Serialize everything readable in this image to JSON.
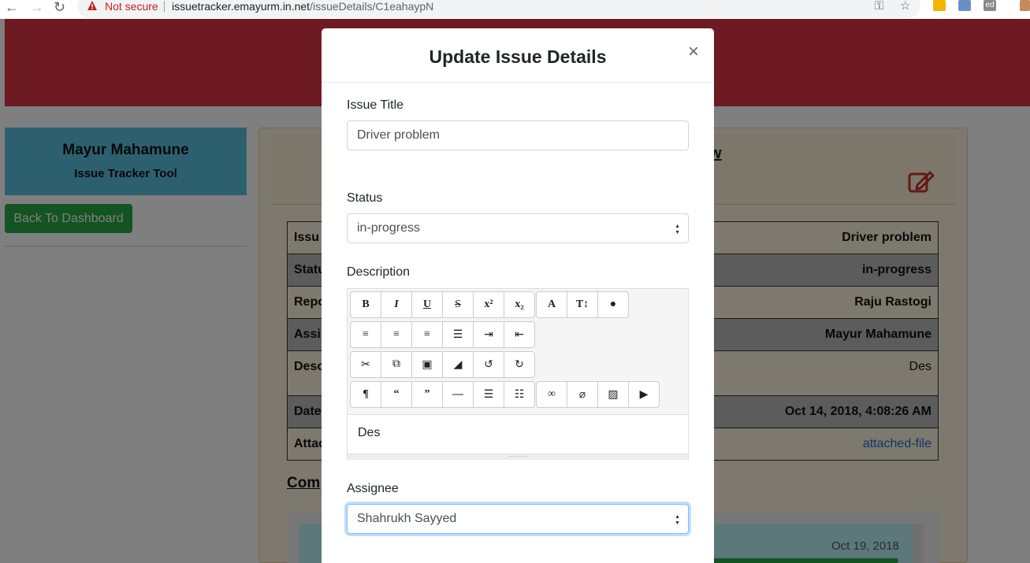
{
  "browser": {
    "not_secure": "Not secure",
    "url_host": "issuetracker.emayurm.in.net",
    "url_path": "/issueDetails/C1eahaypN",
    "ext_label": "ed"
  },
  "sidebar": {
    "name": "Mayur Mahamune",
    "subtitle": "Issue Tracker Tool",
    "back_button": "Back To Dashboard"
  },
  "panel": {
    "title_fragment": "w"
  },
  "issue_rows": [
    {
      "label": "Issu",
      "value": "Driver problem"
    },
    {
      "label": "Statu",
      "value": "in-progress"
    },
    {
      "label": "Repo",
      "value": "Raju Rastogi"
    },
    {
      "label": "Assi",
      "value": "Mayur Mahamune"
    },
    {
      "label": "Desc",
      "value": "Des"
    },
    {
      "label": "Date",
      "value": "Oct 14, 2018, 4:08:26 AM"
    },
    {
      "label": "Attac",
      "value": "attached-file"
    }
  ],
  "comments": {
    "heading": "Com",
    "first_date": "Oct 19, 2018"
  },
  "modal": {
    "title": "Update Issue Details",
    "close": "×",
    "title_label": "Issue Title",
    "title_value": "Driver problem",
    "status_label": "Status",
    "status_value": "in-progress",
    "description_label": "Description",
    "description_value": "Des",
    "assignee_label": "Assignee",
    "assignee_value": "Shahrukh Sayyed"
  },
  "colors": {
    "header_band": "#dc3545",
    "profile_card": "#5bc0de",
    "back_button": "#28a745",
    "overlay": "rgba(0,0,0,0.5)"
  },
  "toolbar": {
    "row1": [
      "bold-icon",
      "italic-icon",
      "underline-icon",
      "strikethrough-icon",
      "superscript-icon",
      "subscript-icon",
      "font-icon",
      "font-size-icon",
      "color-icon"
    ],
    "row2": [
      "align-left-icon",
      "align-center-icon",
      "align-right-icon",
      "justify-icon",
      "indent-icon",
      "outdent-icon"
    ],
    "row3": [
      "cut-icon",
      "copy-icon",
      "delete-icon",
      "eraser-icon",
      "undo-icon",
      "redo-icon"
    ],
    "row4": [
      "paragraph-icon",
      "quote-open-icon",
      "quote-close-icon",
      "horizontal-rule-icon",
      "bullet-list-icon",
      "numbered-list-icon",
      "link-icon",
      "unlink-icon",
      "image-icon",
      "video-icon"
    ]
  }
}
